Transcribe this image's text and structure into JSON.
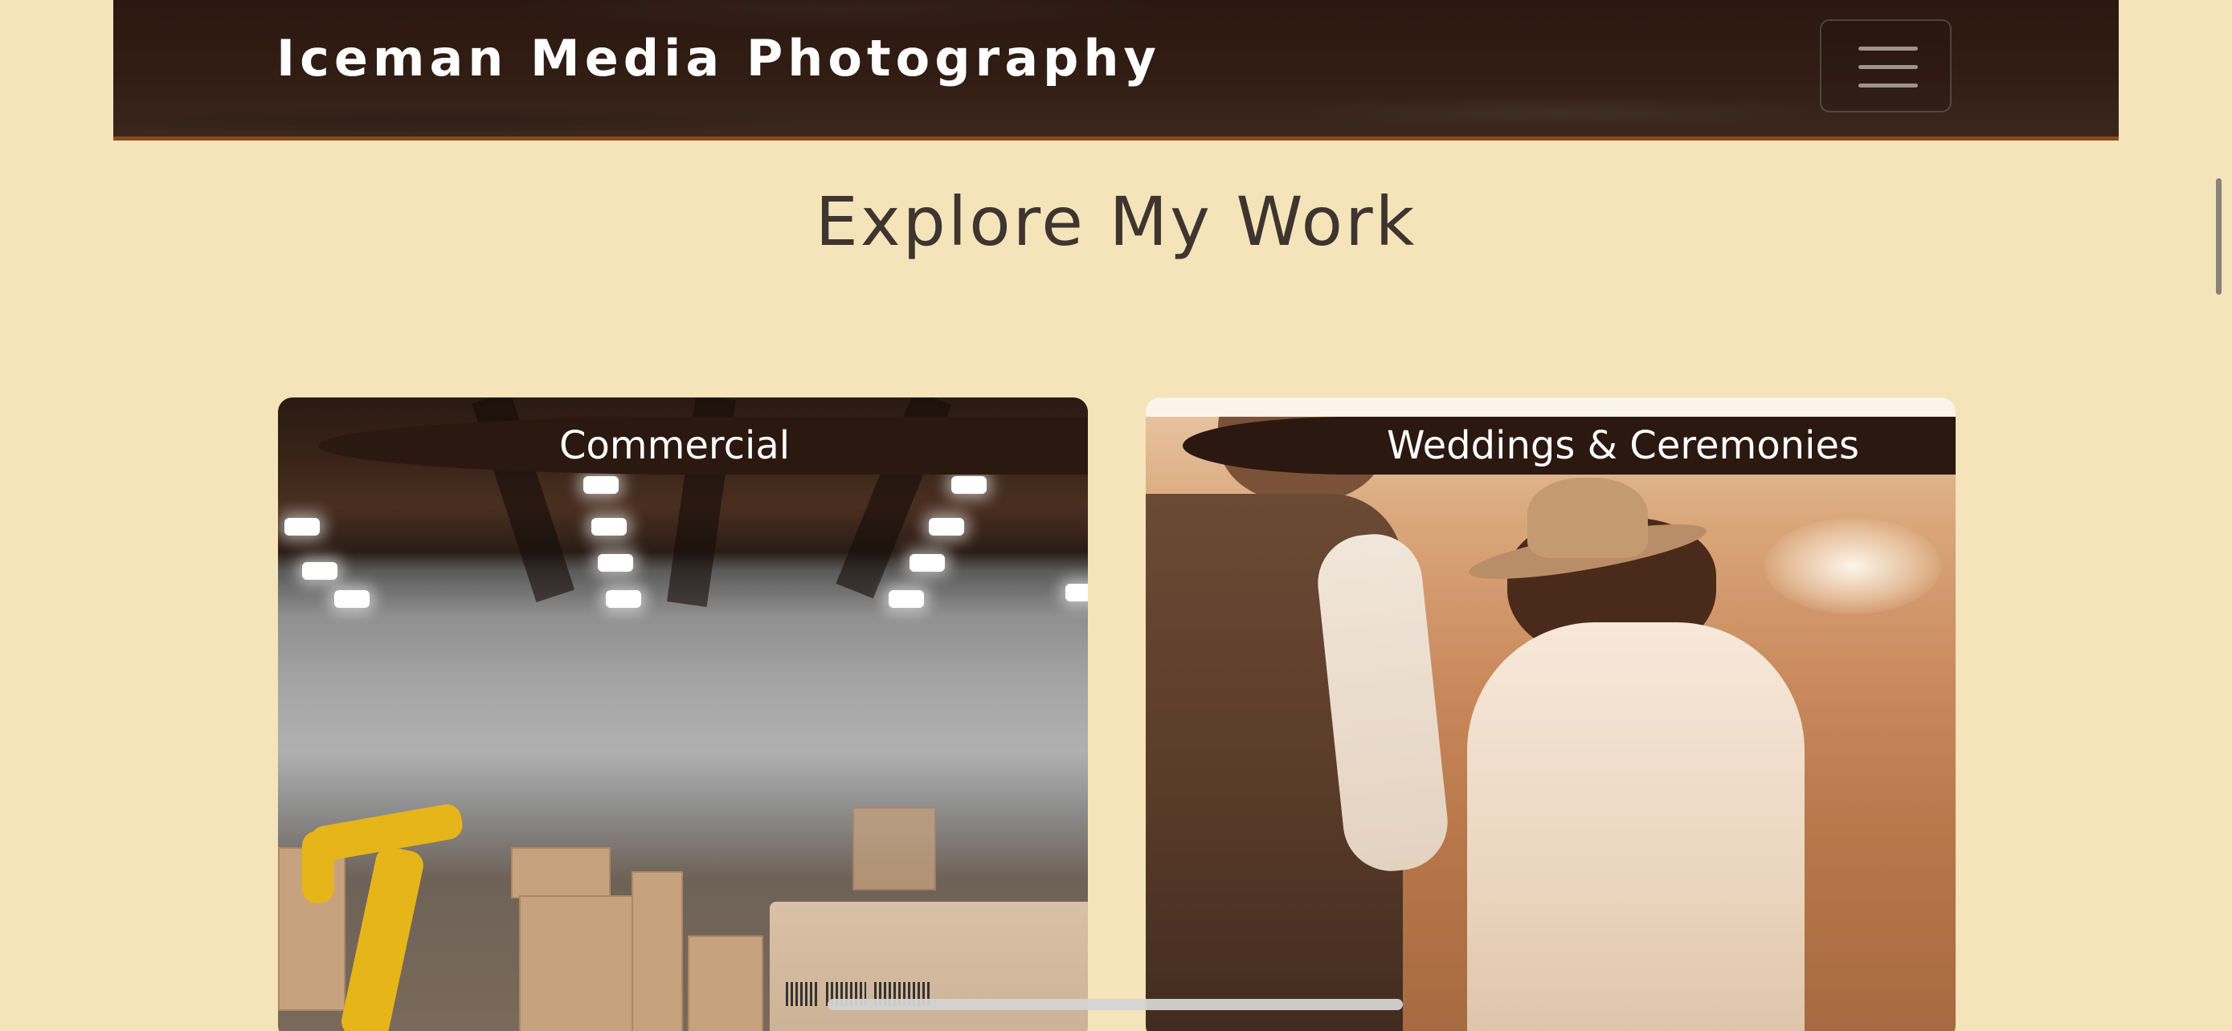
{
  "navbar": {
    "brand": "Iceman Media Photography",
    "menu_icon": "hamburger-menu-icon"
  },
  "main": {
    "section_title": "Explore My Work",
    "cards": [
      {
        "label": "Commercial",
        "image": "warehouse-robot-arm-photo"
      },
      {
        "label": "Weddings & Ceremonies",
        "image": "couple-walking-field-photo"
      }
    ]
  },
  "colors": {
    "page_background": "#f5e4b9",
    "navbar_background": "#2b1810",
    "navbar_accent": "#8a4a1f",
    "heading_text": "#3e3530",
    "label_background": "#2b1810",
    "label_text": "#ffffff"
  }
}
